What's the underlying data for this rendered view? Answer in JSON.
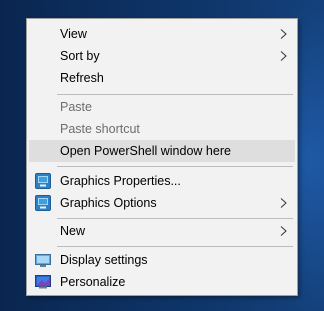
{
  "context_menu": {
    "items": [
      {
        "label": "View",
        "has_submenu": true,
        "enabled": true
      },
      {
        "label": "Sort by",
        "has_submenu": true,
        "enabled": true
      },
      {
        "label": "Refresh",
        "has_submenu": false,
        "enabled": true
      },
      {
        "label": "Paste",
        "has_submenu": false,
        "enabled": false
      },
      {
        "label": "Paste shortcut",
        "has_submenu": false,
        "enabled": false
      },
      {
        "label": "Open PowerShell window here",
        "has_submenu": false,
        "enabled": true,
        "highlighted": true
      },
      {
        "label": "Graphics Properties...",
        "has_submenu": false,
        "enabled": true,
        "icon": "intel-graphics-icon"
      },
      {
        "label": "Graphics Options",
        "has_submenu": true,
        "enabled": true,
        "icon": "intel-graphics-icon"
      },
      {
        "label": "New",
        "has_submenu": true,
        "enabled": true
      },
      {
        "label": "Display settings",
        "has_submenu": false,
        "enabled": true,
        "icon": "display-icon"
      },
      {
        "label": "Personalize",
        "has_submenu": false,
        "enabled": true,
        "icon": "personalize-icon"
      }
    ]
  },
  "colors": {
    "menu_background": "#f2f2f2",
    "highlight": "#dedede",
    "disabled_text": "#6d6d6d",
    "desktop_background": "#0c2b55"
  }
}
